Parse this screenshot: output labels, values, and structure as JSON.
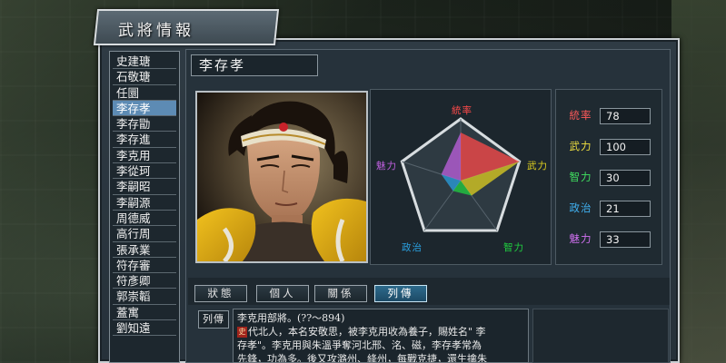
{
  "window": {
    "title": "武將情報"
  },
  "officer_list": [
    "史建瑭",
    "石敬瑭",
    "任圜",
    "李存孝",
    "李存勖",
    "李存進",
    "李克用",
    "李從珂",
    "李嗣昭",
    "李嗣源",
    "周德威",
    "高行周",
    "張承業",
    "符存審",
    "符彥卿",
    "郭崇韜",
    "蓋寓",
    "劉知遠"
  ],
  "selected_officer": "李存孝",
  "officer_name": "李存孝",
  "radar": {
    "labels": {
      "top": "統率",
      "right": "武力",
      "bottom_right": "智力",
      "bottom_left": "政治",
      "left": "魅力"
    },
    "colors": {
      "top": "#ff4a4a",
      "right": "#e0d020",
      "bottom_right": "#20d040",
      "bottom_left": "#2aa0e0",
      "left": "#c060e0"
    }
  },
  "stats": [
    {
      "label": "統率",
      "value": "78",
      "color": "#ff5a5a",
      "fraction": 0.78
    },
    {
      "label": "武力",
      "value": "100",
      "color": "#f0e040",
      "fraction": 1.0
    },
    {
      "label": "智力",
      "value": "30",
      "color": "#40e060",
      "fraction": 0.3
    },
    {
      "label": "政治",
      "value": "21",
      "color": "#40b0f0",
      "fraction": 0.21
    },
    {
      "label": "魅力",
      "value": "33",
      "color": "#d070f0",
      "fraction": 0.33
    }
  ],
  "tabs": [
    {
      "label": "狀態",
      "active": false
    },
    {
      "label": "個人",
      "active": false
    },
    {
      "label": "關係",
      "active": false
    },
    {
      "label": "列傳",
      "active": true
    }
  ],
  "biography": {
    "label": "列傳",
    "mark": "史",
    "lines": [
      "李克用部將。(??～894)",
      "代北人，本名安敬思，被李克用收為養子，賜姓名\" 李",
      "存孝\"。李克用與朱溫爭奪河北邢、洺、磁，李存孝常為",
      "先鋒，功為多。後又攻潞州、絳州，每戰克捷，還生擒朱"
    ]
  }
}
